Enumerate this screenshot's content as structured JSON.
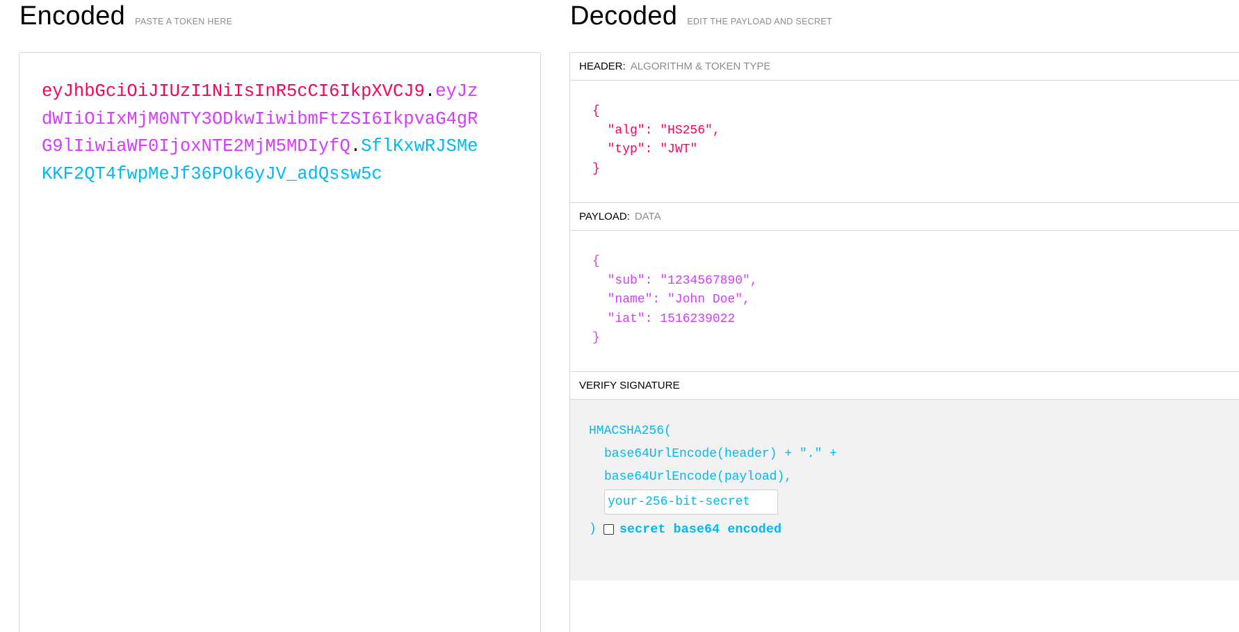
{
  "encoded": {
    "title": "Encoded",
    "subtitle": "PASTE A TOKEN HERE",
    "token_header": "eyJhbGciOiJIUzI1NiIsInR5cCI6IkpXVCJ9",
    "token_payload": "eyJzdWIiOiIxMjM0NTY3ODkwIiwibmFtZSI6IkpvaG4gRG9lIiwiaWF0IjoxNTE2MjM5MDIyfQ",
    "token_signature": "SflKxwRJSMeKKF2QT4fwpMeJf36POk6yJV_adQssw5c",
    "dot": "."
  },
  "decoded": {
    "title": "Decoded",
    "subtitle": "EDIT THE PAYLOAD AND SECRET",
    "header": {
      "label": "HEADER:",
      "note": "ALGORITHM & TOKEN TYPE",
      "json": "{\n  \"alg\": \"HS256\",\n  \"typ\": \"JWT\"\n}"
    },
    "payload": {
      "label": "PAYLOAD:",
      "note": "DATA",
      "json": "{\n  \"sub\": \"1234567890\",\n  \"name\": \"John Doe\",\n  \"iat\": 1516239022\n}"
    },
    "verify": {
      "label": "VERIFY SIGNATURE",
      "func": "HMACSHA256(",
      "line1": "base64UrlEncode(header) + \".\" +",
      "line2": "base64UrlEncode(payload),",
      "secret_placeholder": "your-256-bit-secret",
      "close": ")",
      "checkbox_label": "secret base64 encoded",
      "checkbox_checked": false
    }
  },
  "colors": {
    "header": "#fb015b",
    "payload": "#d63aff",
    "signature": "#00b9f1"
  }
}
